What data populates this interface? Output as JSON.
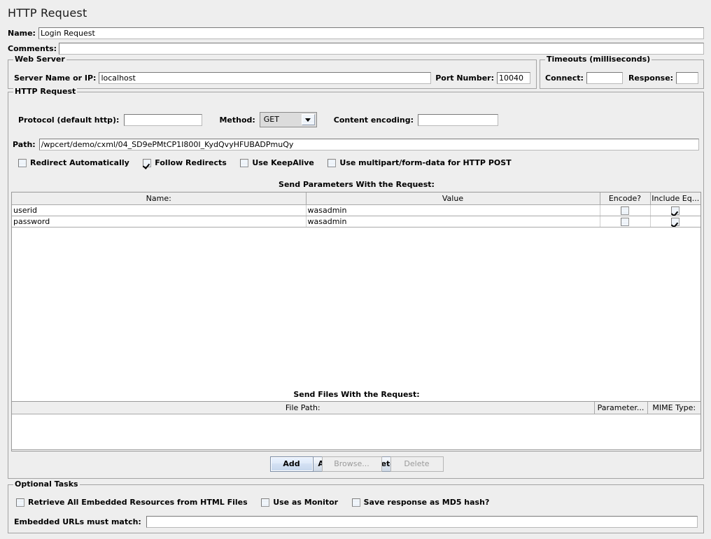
{
  "header": {
    "title": "HTTP Request"
  },
  "top": {
    "name_label": "Name:",
    "name_value": "Login Request",
    "comments_label": "Comments:",
    "comments_value": ""
  },
  "web_server": {
    "legend": "Web Server",
    "server_label": "Server Name or IP:",
    "server_value": "localhost",
    "port_label": "Port Number:",
    "port_value": "10040"
  },
  "timeouts": {
    "legend": "Timeouts (milliseconds)",
    "connect_label": "Connect:",
    "connect_value": "",
    "response_label": "Response:",
    "response_value": ""
  },
  "http_request": {
    "legend": "HTTP Request",
    "protocol_label": "Protocol (default http):",
    "protocol_value": "",
    "method_label": "Method:",
    "method_value": "GET",
    "content_encoding_label": "Content encoding:",
    "content_encoding_value": "",
    "path_label": "Path:",
    "path_value": "/wpcert/demo/cxml/04_SD9ePMtCP1I800I_KydQvyHFUBADPmuQy",
    "options": [
      {
        "label": "Redirect Automatically",
        "checked": false
      },
      {
        "label": "Follow Redirects",
        "checked": true
      },
      {
        "label": "Use KeepAlive",
        "checked": false
      },
      {
        "label": "Use multipart/form-data for HTTP POST",
        "checked": false
      }
    ]
  },
  "parameters": {
    "caption": "Send Parameters With the Request:",
    "columns": [
      "Name:",
      "Value",
      "Encode?",
      "Include Eq..."
    ],
    "rows": [
      {
        "name": "userid",
        "value": "wasadmin",
        "encode": false,
        "include_equals": true
      },
      {
        "name": "password",
        "value": "wasadmin",
        "encode": false,
        "include_equals": true
      }
    ],
    "add_label": "Add",
    "delete_label": "Delete"
  },
  "files": {
    "caption": "Send Files With the Request:",
    "columns": [
      "File Path:",
      "Parameter...",
      "MIME Type:"
    ],
    "rows": [],
    "add_label": "Add",
    "browse_label": "Browse...",
    "delete_label": "Delete"
  },
  "optional_tasks": {
    "legend": "Optional Tasks",
    "options": [
      {
        "label": "Retrieve All Embedded Resources from HTML Files",
        "checked": false
      },
      {
        "label": "Use as Monitor",
        "checked": false
      },
      {
        "label": "Save response as MD5 hash?",
        "checked": false
      }
    ],
    "embedded_urls_label": "Embedded URLs must match:",
    "embedded_urls_value": ""
  },
  "colors": {
    "background": "#eeeeee",
    "field_background": "#ffffff",
    "border": "#a3a3a3",
    "checkbox_fill": "#e8f0fa"
  }
}
